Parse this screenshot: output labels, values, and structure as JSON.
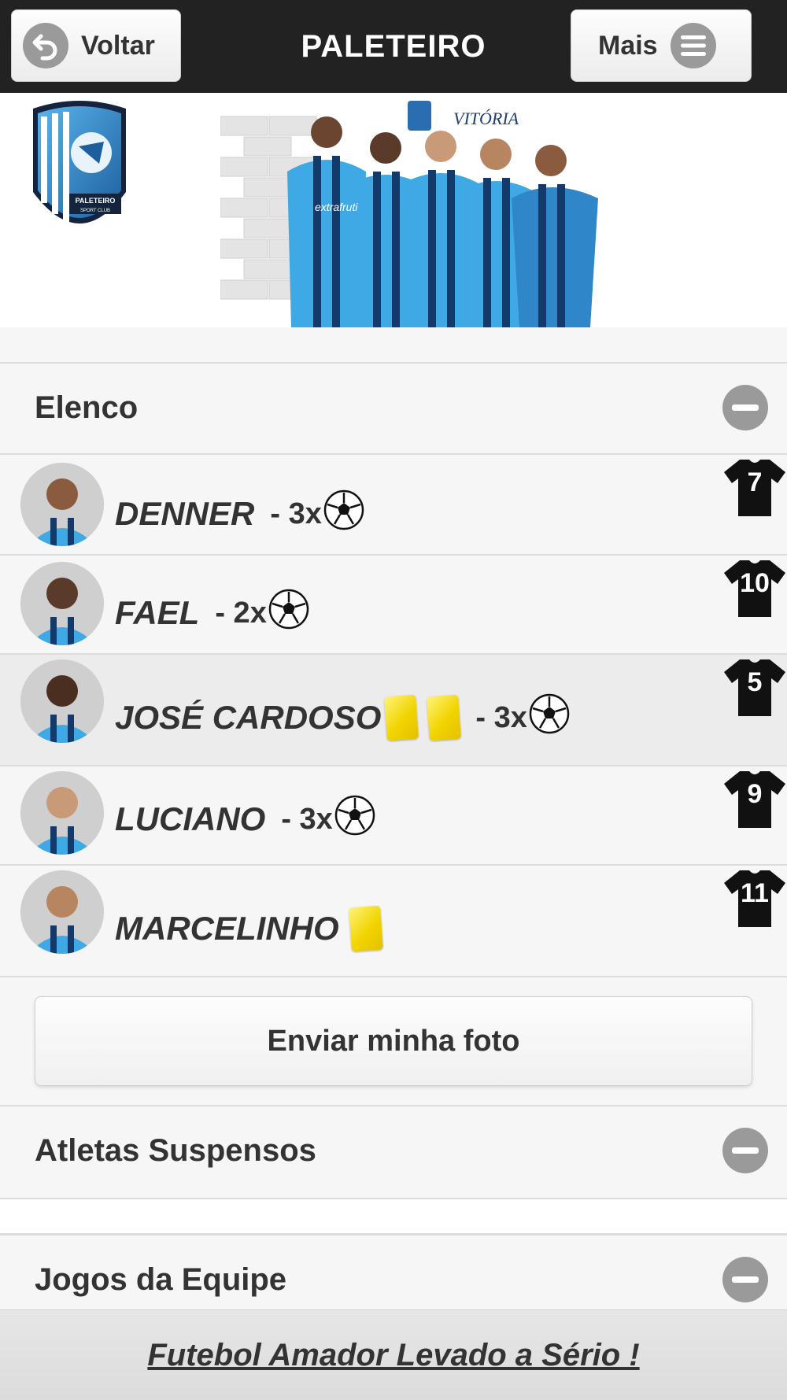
{
  "header": {
    "back_label": "Voltar",
    "title": "PALETEIRO",
    "more_label": "Mais"
  },
  "banner": {
    "logo_text": "PALETEIRO",
    "logo_subtext": "SPORT CLUB",
    "sponsor_text": "VITÓRIA",
    "shirt_text": "extrafruti"
  },
  "sections": {
    "elenco": "Elenco",
    "suspensos": "Atletas Suspensos",
    "jogos": "Jogos da Equipe"
  },
  "players": [
    {
      "name": "DENNER",
      "goals": "- 3x",
      "yellow_cards": 0,
      "number": "7"
    },
    {
      "name": "FAEL",
      "goals": "- 2x",
      "yellow_cards": 0,
      "number": "10"
    },
    {
      "name": "JOSÉ CARDOSO",
      "goals": "- 3x",
      "yellow_cards": 2,
      "number": "5"
    },
    {
      "name": "LUCIANO",
      "goals": "- 3x",
      "yellow_cards": 0,
      "number": "9"
    },
    {
      "name": "MARCELINHO",
      "goals": "",
      "yellow_cards": 1,
      "number": "11"
    }
  ],
  "send_photo_label": "Enviar minha foto",
  "footer_text": "Futebol Amador Levado a Sério !",
  "icons": {
    "back": "back-arrow-icon",
    "more": "menu-icon",
    "collapse": "minus-icon",
    "goal": "soccer-ball-icon",
    "card": "yellow-card-icon",
    "jersey": "jersey-icon"
  },
  "colors": {
    "header_bg": "#222222",
    "player_shirt": "#3fa9e6",
    "card_yellow": "#f2d400"
  }
}
